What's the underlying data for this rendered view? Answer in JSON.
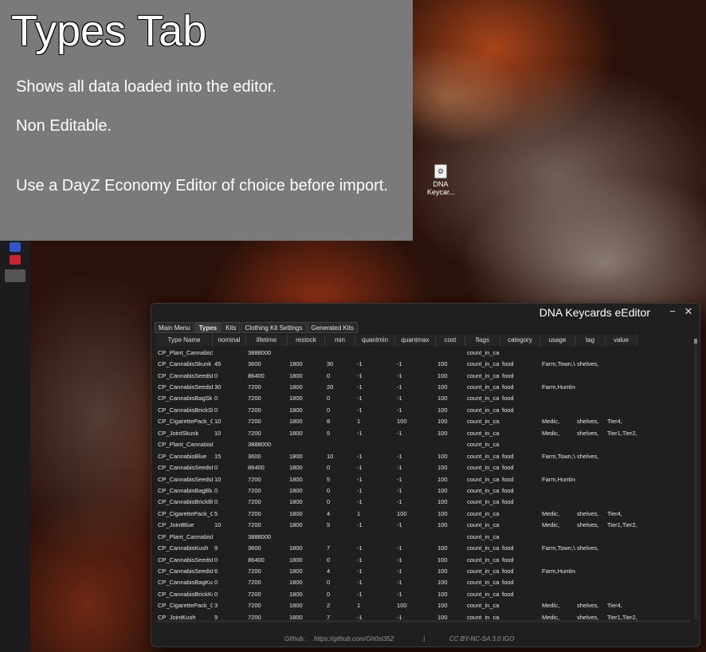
{
  "overlay": {
    "title": "Types Tab",
    "line1": "Shows all data loaded into the editor.",
    "line2": "Non Editable.",
    "line3": "Use a DayZ Economy Editor of choice before import."
  },
  "desktop_icon": {
    "label": "DNA Keycar..."
  },
  "window": {
    "title": "DNA Keycards eEditor",
    "minimize": "−",
    "close": "✕",
    "tabs": [
      "Main Menu",
      "Types",
      "Kits",
      "Clothing Kit Settings",
      "Generated Kits"
    ],
    "active_tab": "Types",
    "columns": [
      "Type Name",
      "nominal",
      "lifetime",
      "restock",
      "min",
      "quantmin",
      "quantmax",
      "cost",
      "flags",
      "category",
      "usage",
      "tag",
      "value"
    ],
    "rows": [
      [
        "CP_Plant_CannabisS",
        "",
        "3888000",
        "",
        "",
        "",
        "",
        "",
        "count_in_ca",
        "",
        "",
        "",
        ""
      ],
      [
        "CP_CannabisSkunk",
        "45",
        "3600",
        "1800",
        "30",
        "-1",
        "-1",
        "100",
        "count_in_ca",
        "food",
        "Farm,Town,Vil",
        "shelves,",
        ""
      ],
      [
        "CP_CannabisSeedsF",
        "0",
        "86400",
        "1800",
        "0",
        "-1",
        "-1",
        "100",
        "count_in_ca",
        "food",
        "",
        "",
        ""
      ],
      [
        "CP_CannabisSeedsF",
        "30",
        "7200",
        "1800",
        "20",
        "-1",
        "-1",
        "100",
        "count_in_ca",
        "food",
        "Farm,Hunting",
        "",
        ""
      ],
      [
        "CP_CannabisBagSk",
        "0",
        "7200",
        "1800",
        "0",
        "-1",
        "-1",
        "100",
        "count_in_ca",
        "food",
        "",
        "",
        ""
      ],
      [
        "CP_CannabisBrickSk",
        "0",
        "7200",
        "1800",
        "0",
        "-1",
        "-1",
        "100",
        "count_in_ca",
        "food",
        "",
        "",
        ""
      ],
      [
        "CP_CigarettePack_C",
        "10",
        "7200",
        "1800",
        "8",
        "1",
        "100",
        "100",
        "count_in_ca",
        "",
        "Medic,",
        "shelves,",
        "Tier4,"
      ],
      [
        "CP_JointSkunk",
        "10",
        "7200",
        "1800",
        "5",
        "-1",
        "-1",
        "100",
        "count_in_ca",
        "",
        "Medic,",
        "shelves,",
        "Tier1,Tier2,"
      ],
      [
        "CP_Plant_CannabisE",
        "",
        "3888000",
        "",
        "",
        "",
        "",
        "",
        "count_in_ca",
        "",
        "",
        "",
        ""
      ],
      [
        "CP_CannabisBlue",
        "15",
        "3600",
        "1800",
        "10",
        "-1",
        "-1",
        "100",
        "count_in_ca",
        "food",
        "Farm,Town,Vil",
        "shelves,",
        ""
      ],
      [
        "CP_CannabisSeedsF",
        "0",
        "86400",
        "1800",
        "0",
        "-1",
        "-1",
        "100",
        "count_in_ca",
        "food",
        "",
        "",
        ""
      ],
      [
        "CP_CannabisSeedsF",
        "10",
        "7200",
        "1800",
        "5",
        "-1",
        "-1",
        "100",
        "count_in_ca",
        "food",
        "Farm,Hunting",
        "",
        ""
      ],
      [
        "CP_CannabisBagBlu",
        "0",
        "7200",
        "1800",
        "0",
        "-1",
        "-1",
        "100",
        "count_in_ca",
        "food",
        "",
        "",
        ""
      ],
      [
        "CP_CannabisBrickBl",
        "0",
        "7200",
        "1800",
        "0",
        "-1",
        "-1",
        "100",
        "count_in_ca",
        "food",
        "",
        "",
        ""
      ],
      [
        "CP_CigarettePack_C",
        "5",
        "7200",
        "1800",
        "4",
        "1",
        "100",
        "100",
        "count_in_ca",
        "",
        "Medic,",
        "shelves,",
        "Tier4,"
      ],
      [
        "CP_JointBlue",
        "10",
        "7200",
        "1800",
        "5",
        "-1",
        "-1",
        "100",
        "count_in_ca",
        "",
        "Medic,",
        "shelves,",
        "Tier1,Tier2,"
      ],
      [
        "CP_Plant_CannabisI",
        "",
        "3888000",
        "",
        "",
        "",
        "",
        "",
        "count_in_ca",
        "",
        "",
        "",
        ""
      ],
      [
        "CP_CannabisKush",
        "9",
        "3600",
        "1800",
        "7",
        "-1",
        "-1",
        "100",
        "count_in_ca",
        "food",
        "Farm,Town,Vil",
        "shelves,",
        ""
      ],
      [
        "CP_CannabisSeedsF",
        "0",
        "86400",
        "1800",
        "0",
        "-1",
        "-1",
        "100",
        "count_in_ca",
        "food",
        "",
        "",
        ""
      ],
      [
        "CP_CannabisSeedsF",
        "6",
        "7200",
        "1800",
        "4",
        "-1",
        "-1",
        "100",
        "count_in_ca",
        "food",
        "Farm,Hunting",
        "",
        ""
      ],
      [
        "CP_CannabisBagKu",
        "0",
        "7200",
        "1800",
        "0",
        "-1",
        "-1",
        "100",
        "count_in_ca",
        "food",
        "",
        "",
        ""
      ],
      [
        "CP_CannabisBrickKu",
        "0",
        "7200",
        "1800",
        "0",
        "-1",
        "-1",
        "100",
        "count_in_ca",
        "food",
        "",
        "",
        ""
      ],
      [
        "CP_CigarettePack_C",
        "3",
        "7200",
        "1800",
        "2",
        "1",
        "100",
        "100",
        "count_in_ca",
        "",
        "Medic,",
        "shelves,",
        "Tier4,"
      ],
      [
        "CP_JointKush",
        "9",
        "7200",
        "1800",
        "7",
        "-1",
        "-1",
        "100",
        "count_in_ca",
        "",
        "Medic,",
        "shelves,",
        "Tier1,Tier2,"
      ]
    ],
    "footer": {
      "github_label": "Github:",
      "github_url": "https://github.com/Gh0st352",
      "separator": "|",
      "license": "CC BY-NC-SA 3.0 IGO"
    }
  }
}
